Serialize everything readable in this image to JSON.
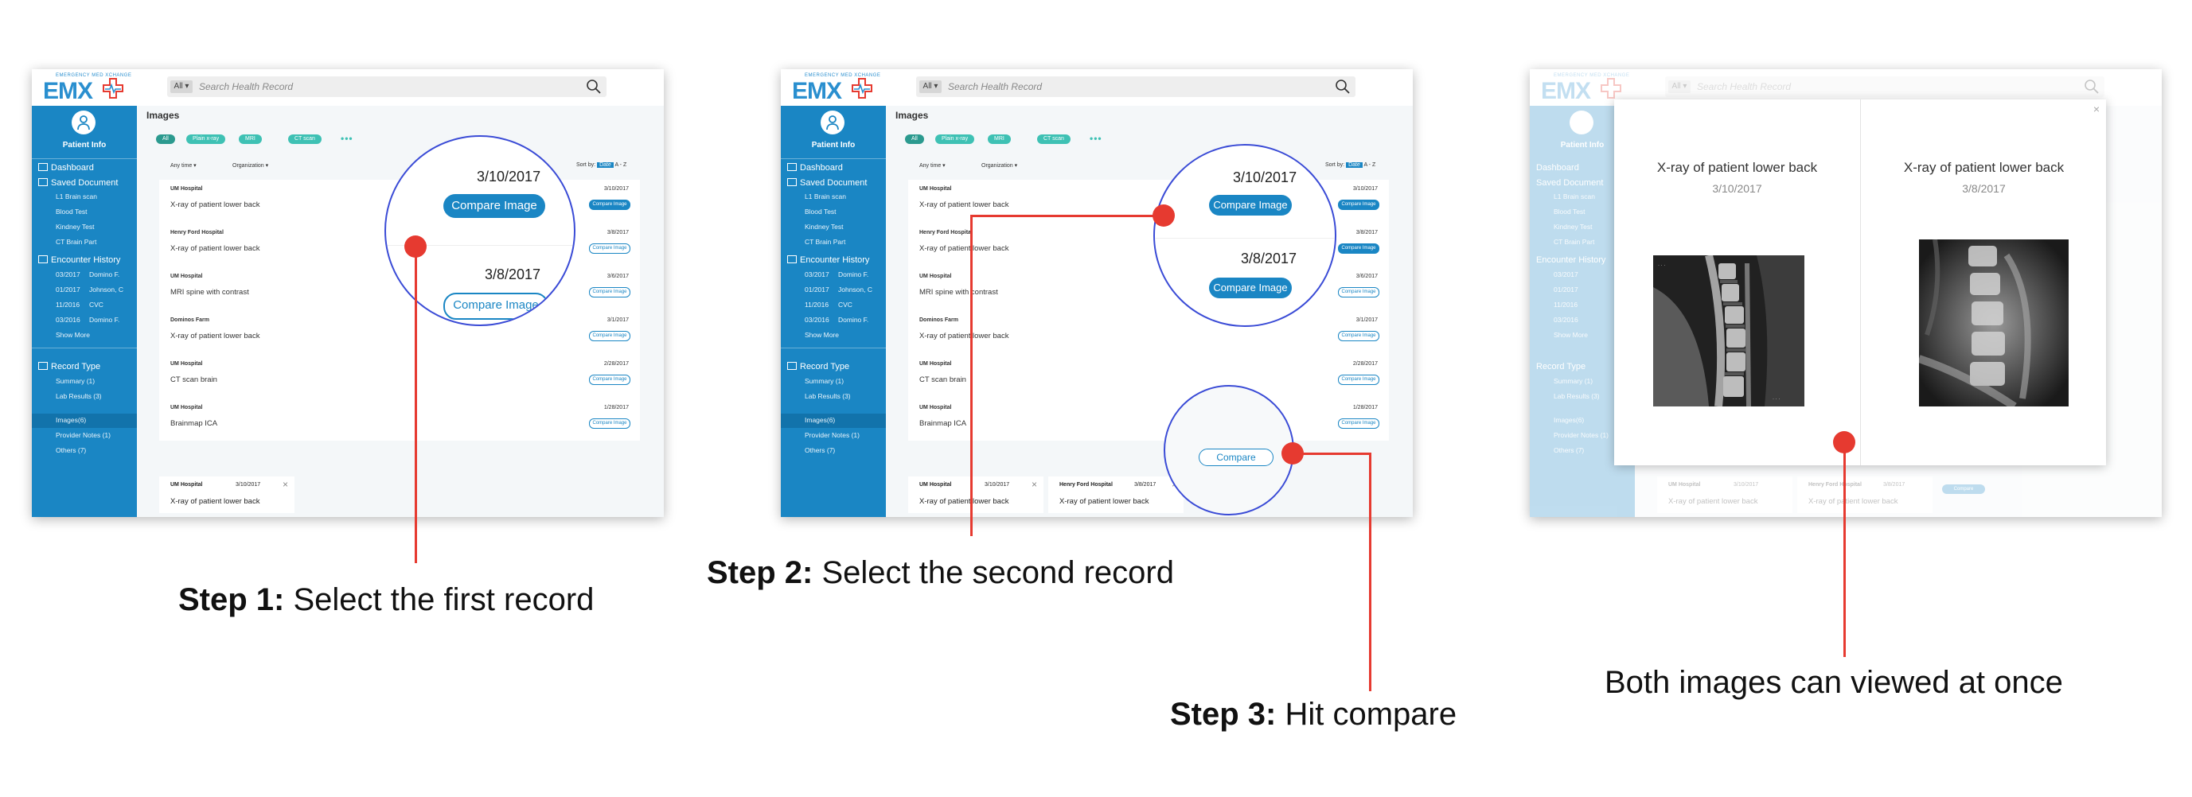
{
  "app": {
    "logo_text": "EMX",
    "logo_tagline": "EMERGENCY MED XCHANGE",
    "search_scope": "All",
    "search_placeholder": "Search Health Record"
  },
  "sidebar": {
    "patient_label": "Patient Info",
    "dashboard": "Dashboard",
    "saved_document": "Saved Document",
    "saved_items": [
      "L1 Brain scan",
      "Blood Test",
      "Kindney Test",
      "CT Brain Part"
    ],
    "encounter_history": "Encounter History",
    "encounters": [
      {
        "date": "03/2017",
        "name": "Domino F."
      },
      {
        "date": "01/2017",
        "name": "Johnson, C"
      },
      {
        "date": "11/2016",
        "name": "CVC"
      },
      {
        "date": "03/2016",
        "name": "Domino F."
      }
    ],
    "show_more": "Show More",
    "record_type": "Record Type",
    "record_items": [
      "Summary (1)",
      "Lab Results (3)",
      "Images(6)",
      "Provider Notes (1)",
      "Others (7)"
    ]
  },
  "main": {
    "page_title": "Images",
    "filter_pills": [
      "All",
      "Plain x-ray",
      "MRI",
      "CT scan"
    ],
    "more_dots": "•••",
    "filter_time": "Any time ▾",
    "filter_org": "Organization ▾",
    "sort_label": "Sort by:",
    "sort_active": "Date",
    "sort_alt": "A - Z",
    "compare_label": "Compare Image",
    "records": [
      {
        "org": "UM Hospital",
        "desc": "X-ray of patient lower back",
        "date": "3/10/2017"
      },
      {
        "org": "Henry Ford Hospital",
        "desc": "X-ray of patient lower back",
        "date": "3/8/2017"
      },
      {
        "org": "UM Hospital",
        "desc": "MRI spine with contrast",
        "date": "3/6/2017"
      },
      {
        "org": "Dominos Farm",
        "desc": "X-ray of patient lower back",
        "date": "3/1/2017"
      },
      {
        "org": "UM Hospital",
        "desc": "CT scan brain",
        "date": "2/28/2017"
      },
      {
        "org": "UM Hospital",
        "desc": "Brainmap ICA",
        "date": "1/28/2017"
      }
    ],
    "selected": [
      {
        "org": "UM Hospital",
        "date": "3/10/2017",
        "desc": "X-ray of patient lower back"
      },
      {
        "org": "Henry Ford Hospital",
        "date": "3/8/2017",
        "desc": "X-ray of patient lower back"
      }
    ],
    "compare_button": "Compare",
    "close_glyph": "×"
  },
  "magnifier": {
    "date_1": "3/10/2017",
    "date_2": "3/8/2017",
    "button": "Compare Image"
  },
  "modal": {
    "left_title": "X-ray of patient lower back",
    "left_date": "3/10/2017",
    "right_title": "X-ray of patient lower back",
    "right_date": "3/8/2017"
  },
  "captions": {
    "step1_bold": "Step 1:",
    "step1_text": " Select the first record",
    "step2_bold": "Step 2:",
    "step2_text": " Select the second record",
    "step3_bold": "Step 3:",
    "step3_text": " Hit compare",
    "result_text": "Both images can viewed at once"
  },
  "colors": {
    "brand_blue": "#1a86c4",
    "pill_teal": "#3ec1b4",
    "annotation_red": "#e63a30",
    "magnifier_ring": "#3a4bd6"
  }
}
